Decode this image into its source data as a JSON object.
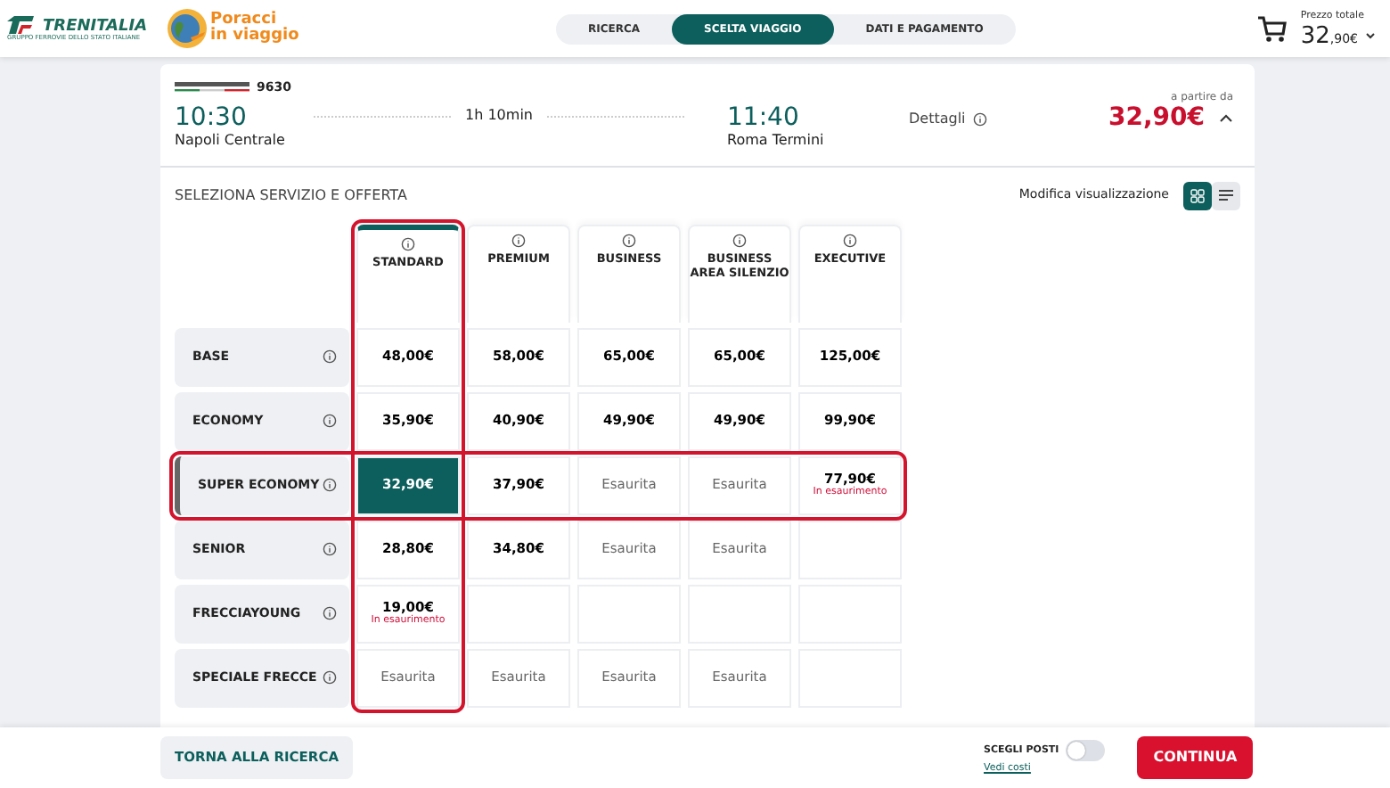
{
  "header": {
    "brand": {
      "name": "TRENITALIA",
      "tagline": "GRUPPO FERROVIE DELLO STATO ITALIANE"
    },
    "partner": {
      "line_1": "Poracci",
      "line_2": "in viaggio"
    },
    "steps": [
      {
        "label": "RICERCA",
        "selected": false
      },
      {
        "label": "SCELTA VIAGGIO",
        "selected": true
      },
      {
        "label": "DATI E PAGAMENTO",
        "selected": false
      }
    ],
    "total": {
      "label": "Prezzo totale",
      "euros": "32",
      "cents": ",90€"
    }
  },
  "train": {
    "number": "9630",
    "departure": {
      "time": "10:30",
      "station": "Napoli Centrale"
    },
    "duration": "1h 10min",
    "arrival": {
      "time": "11:40",
      "station": "Roma Termini"
    },
    "details": "Dettagli",
    "price_label": "a partire da",
    "price": "32,90€",
    "expanded": true
  },
  "offer": {
    "title": "SELEZIONA SERVIZIO E OFFERTA",
    "view_label": "Modifica visualizzazione",
    "views": [
      {
        "kind": "grid",
        "selected": true
      },
      {
        "kind": "list",
        "selected": false
      }
    ],
    "columns": [
      {
        "label": "STANDARD",
        "highlighted": true
      },
      {
        "label": "PREMIUM",
        "highlighted": false
      },
      {
        "label": "BUSINESS",
        "highlighted": false
      },
      {
        "label": "BUSINESS AREA SILENZIO",
        "highlighted": false
      },
      {
        "label": "EXECUTIVE",
        "highlighted": false
      }
    ],
    "rows": [
      {
        "label": "BASE",
        "highlighted": false,
        "cells": [
          {
            "kind": "price",
            "text": "48,00€",
            "selected": false
          },
          {
            "kind": "price",
            "text": "58,00€",
            "selected": false
          },
          {
            "kind": "price",
            "text": "65,00€",
            "selected": false
          },
          {
            "kind": "price",
            "text": "65,00€",
            "selected": false
          },
          {
            "kind": "price",
            "text": "125,00€",
            "selected": false
          }
        ]
      },
      {
        "label": "ECONOMY",
        "highlighted": false,
        "cells": [
          {
            "kind": "price",
            "text": "35,90€",
            "selected": false
          },
          {
            "kind": "price",
            "text": "40,90€",
            "selected": false
          },
          {
            "kind": "price",
            "text": "49,90€",
            "selected": false
          },
          {
            "kind": "price",
            "text": "49,90€",
            "selected": false
          },
          {
            "kind": "price",
            "text": "99,90€",
            "selected": false
          }
        ]
      },
      {
        "label": "SUPER ECONOMY",
        "highlighted": true,
        "cells": [
          {
            "kind": "price",
            "text": "32,90€",
            "selected": true
          },
          {
            "kind": "price",
            "text": "37,90€",
            "selected": false
          },
          {
            "kind": "soldout",
            "text": "Esaurita",
            "selected": false
          },
          {
            "kind": "soldout",
            "text": "Esaurita",
            "selected": false
          },
          {
            "kind": "price",
            "text": "77,90€",
            "note": "In esaurimento",
            "selected": false
          }
        ]
      },
      {
        "label": "SENIOR",
        "highlighted": false,
        "cells": [
          {
            "kind": "price",
            "text": "28,80€",
            "selected": false
          },
          {
            "kind": "price",
            "text": "34,80€",
            "selected": false
          },
          {
            "kind": "soldout",
            "text": "Esaurita",
            "selected": false
          },
          {
            "kind": "soldout",
            "text": "Esaurita",
            "selected": false
          },
          {
            "kind": "empty",
            "selected": false
          }
        ]
      },
      {
        "label": "FRECCIAYOUNG",
        "highlighted": false,
        "cells": [
          {
            "kind": "price",
            "text": "19,00€",
            "note": "In esaurimento",
            "selected": false
          },
          {
            "kind": "empty",
            "selected": false
          },
          {
            "kind": "empty",
            "selected": false
          },
          {
            "kind": "empty",
            "selected": false
          },
          {
            "kind": "empty",
            "selected": false
          }
        ]
      },
      {
        "label": "SPECIALE FRECCE",
        "highlighted": false,
        "cells": [
          {
            "kind": "soldout",
            "text": "Esaurita",
            "selected": false
          },
          {
            "kind": "soldout",
            "text": "Esaurita",
            "selected": false
          },
          {
            "kind": "soldout",
            "text": "Esaurita",
            "selected": false
          },
          {
            "kind": "soldout",
            "text": "Esaurita",
            "selected": false
          },
          {
            "kind": "empty",
            "selected": false
          }
        ]
      }
    ]
  },
  "footer": {
    "back": "TORNA ALLA RICERCA",
    "seats": {
      "label": "SCEGLI POSTI",
      "on": false,
      "link": "Vedi costi"
    },
    "continue": "CONTINUA"
  }
}
